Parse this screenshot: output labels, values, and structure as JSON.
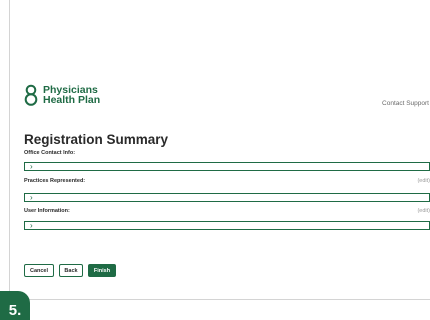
{
  "header": {
    "logo_line1": "Physicians",
    "logo_line2": "Health Plan",
    "contact_support": "Contact Support",
    "brand_color": "#1f6b45"
  },
  "main": {
    "title": "Registration Summary",
    "sections": [
      {
        "label": "Office Contact Info:",
        "edit": ""
      },
      {
        "label": "Practices Represented:",
        "edit": "(edit)"
      },
      {
        "label": "User Information:",
        "edit": "(edit)"
      }
    ],
    "expand_glyph": "›"
  },
  "buttons": {
    "cancel": "Cancel",
    "back": "Back",
    "finish": "Finish"
  },
  "step_badge": "5."
}
